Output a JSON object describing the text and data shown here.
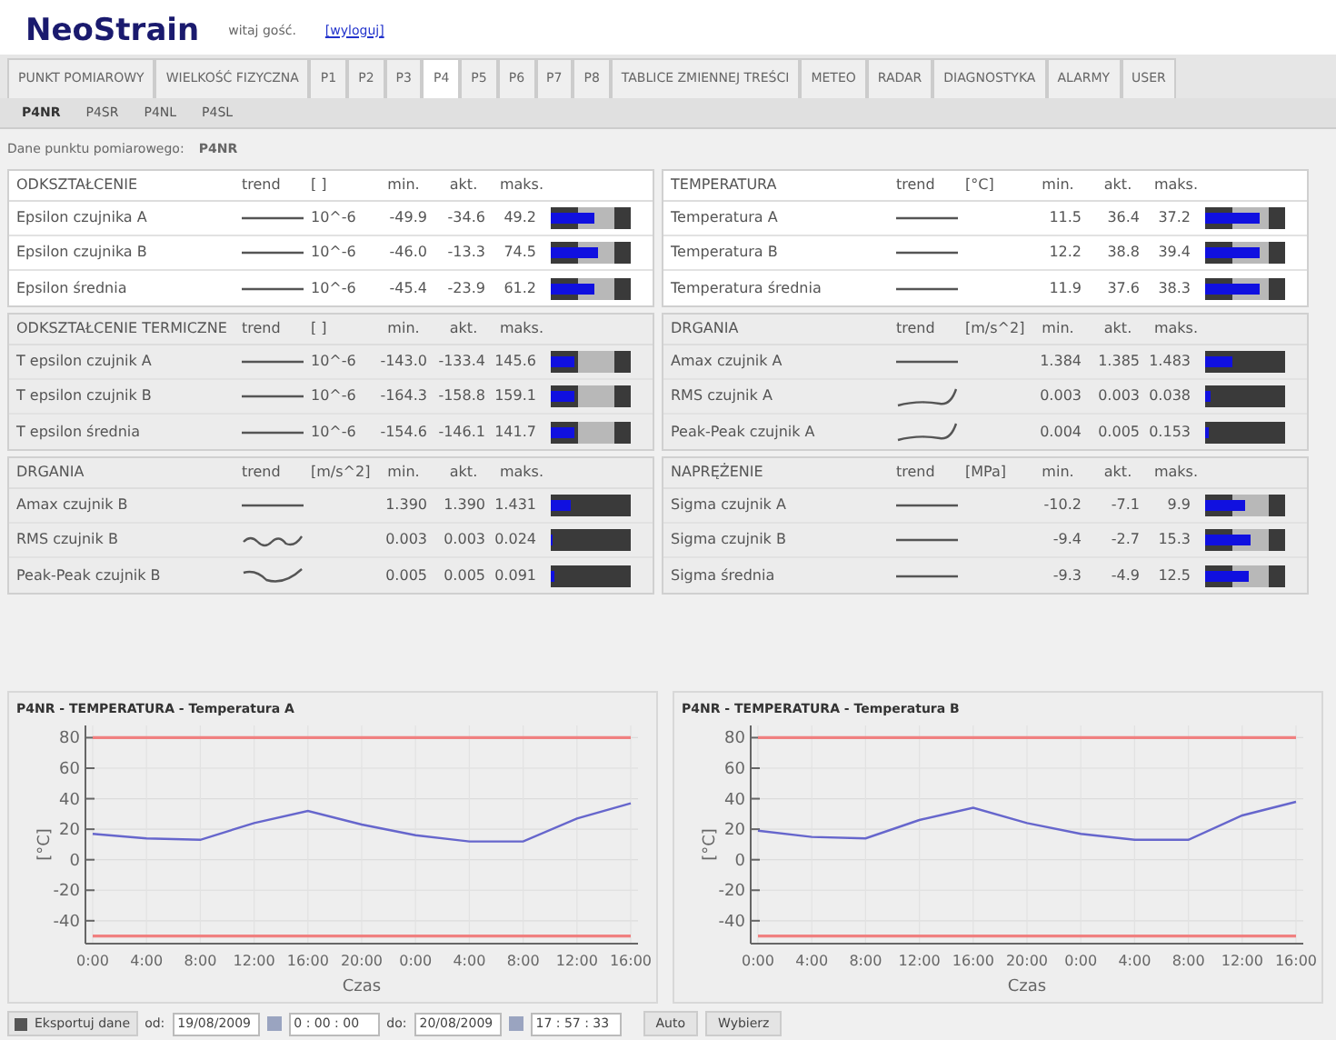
{
  "header": {
    "logo": "NeoStrain",
    "greeting": "witaj gość.",
    "logout": "[wyloguj]"
  },
  "tabs": [
    {
      "label": "PUNKT POMIAROWY",
      "selected": false
    },
    {
      "label": "WIELKOŚĆ FIZYCZNA",
      "selected": false
    },
    {
      "label": "P1",
      "selected": false
    },
    {
      "label": "P2",
      "selected": false
    },
    {
      "label": "P3",
      "selected": false
    },
    {
      "label": "P4",
      "selected": true
    },
    {
      "label": "P5",
      "selected": false
    },
    {
      "label": "P6",
      "selected": false
    },
    {
      "label": "P7",
      "selected": false
    },
    {
      "label": "P8",
      "selected": false
    },
    {
      "label": "TABLICE ZMIENNEJ TREŚCI",
      "selected": false
    },
    {
      "label": "METEO",
      "selected": false
    },
    {
      "label": "RADAR",
      "selected": false
    },
    {
      "label": "DIAGNOSTYKA",
      "selected": false
    },
    {
      "label": "ALARMY",
      "selected": false
    },
    {
      "label": "USER",
      "selected": false
    }
  ],
  "subtabs": [
    {
      "label": "P4NR",
      "selected": true
    },
    {
      "label": "P4SR",
      "selected": false
    },
    {
      "label": "P4NL",
      "selected": false
    },
    {
      "label": "P4SL",
      "selected": false
    }
  ],
  "point_label": "Dane punktu pomiarowego:",
  "point_value": "P4NR",
  "panels": [
    {
      "title": "ODKSZTAŁCENIE",
      "trend": "trend",
      "unit": "[ ]",
      "min": "min.",
      "akt": "akt.",
      "maks": "maks.",
      "highlight": true,
      "rows": [
        {
          "name": "Epsilon czujnika A",
          "kind": "flat",
          "unit": "10^-6",
          "min": "-49.9",
          "akt": "-34.6",
          "maks": "49.2",
          "band": true,
          "level": 0.55
        },
        {
          "name": "Epsilon czujnika B",
          "kind": "flat",
          "unit": "10^-6",
          "min": "-46.0",
          "akt": "-13.3",
          "maks": "74.5",
          "band": true,
          "level": 0.58
        },
        {
          "name": "Epsilon średnia",
          "kind": "flat",
          "unit": "10^-6",
          "min": "-45.4",
          "akt": "-23.9",
          "maks": "61.2",
          "band": true,
          "level": 0.55
        }
      ]
    },
    {
      "title": "TEMPERATURA",
      "trend": "trend",
      "unit": "[°C]",
      "min": "min.",
      "akt": "akt.",
      "maks": "maks.",
      "highlight": true,
      "rows": [
        {
          "name": "Temperatura A",
          "kind": "flat",
          "min": "11.5",
          "akt": "36.4",
          "maks": "37.2",
          "band": true,
          "level": 0.68
        },
        {
          "name": "Temperatura B",
          "kind": "flat",
          "min": "12.2",
          "akt": "38.8",
          "maks": "39.4",
          "band": true,
          "level": 0.68
        },
        {
          "name": "Temperatura średnia",
          "kind": "flat",
          "min": "11.9",
          "akt": "37.6",
          "maks": "38.3",
          "band": true,
          "level": 0.68
        }
      ]
    },
    {
      "title": "ODKSZTAŁCENIE TERMICZNE",
      "trend": "trend",
      "unit": "[ ]",
      "min": "min.",
      "akt": "akt.",
      "maks": "maks.",
      "highlight": false,
      "rows": [
        {
          "name": "T epsilon czujnik A",
          "kind": "flat",
          "unit": "10^-6",
          "min": "-143.0",
          "akt": "-133.4",
          "maks": "145.6",
          "band": true,
          "level": 0.3
        },
        {
          "name": "T epsilon czujnik B",
          "kind": "flat",
          "unit": "10^-6",
          "min": "-164.3",
          "akt": "-158.8",
          "maks": "159.1",
          "band": true,
          "level": 0.3
        },
        {
          "name": "T epsilon średnia",
          "kind": "flat",
          "unit": "10^-6",
          "min": "-154.6",
          "akt": "-146.1",
          "maks": "141.7",
          "band": true,
          "level": 0.3
        }
      ]
    },
    {
      "title": "DRGANIA",
      "trend": "trend",
      "unit": "[m/s^2]",
      "min": "min.",
      "akt": "akt.",
      "maks": "maks.",
      "highlight": false,
      "rows": [
        {
          "name": "Amax czujnik A",
          "kind": "flat",
          "min": "1.384",
          "akt": "1.385",
          "maks": "1.483",
          "band": false,
          "level": 0.35
        },
        {
          "name": "RMS czujnik A",
          "kind": "rise",
          "min": "0.003",
          "akt": "0.003",
          "maks": "0.038",
          "band": false,
          "level": 0.06
        },
        {
          "name": "Peak-Peak czujnik A",
          "kind": "rise",
          "min": "0.004",
          "akt": "0.005",
          "maks": "0.153",
          "band": false,
          "level": 0.04
        }
      ]
    },
    {
      "title": "DRGANIA",
      "trend": "trend",
      "unit": "[m/s^2]",
      "min": "min.",
      "akt": "akt.",
      "maks": "maks.",
      "highlight": false,
      "rows": [
        {
          "name": "Amax czujnik B",
          "kind": "flat",
          "min": "1.390",
          "akt": "1.390",
          "maks": "1.431",
          "band": false,
          "level": 0.25
        },
        {
          "name": "RMS czujnik B",
          "kind": "wavy",
          "min": "0.003",
          "akt": "0.003",
          "maks": "0.024",
          "band": false,
          "level": 0.03
        },
        {
          "name": "Peak-Peak czujnik B",
          "kind": "dip",
          "min": "0.005",
          "akt": "0.005",
          "maks": "0.091",
          "band": false,
          "level": 0.04
        }
      ]
    },
    {
      "title": "NAPRĘŻENIE",
      "trend": "trend",
      "unit": "[MPa]",
      "min": "min.",
      "akt": "akt.",
      "maks": "maks.",
      "highlight": false,
      "rows": [
        {
          "name": "Sigma czujnik A",
          "kind": "flat",
          "min": "-10.2",
          "akt": "-7.1",
          "maks": "9.9",
          "band": true,
          "level": 0.5
        },
        {
          "name": "Sigma czujnik B",
          "kind": "flat",
          "min": "-9.4",
          "akt": "-2.7",
          "maks": "15.3",
          "band": true,
          "level": 0.57
        },
        {
          "name": "Sigma średnia",
          "kind": "flat",
          "min": "-9.3",
          "akt": "-4.9",
          "maks": "12.5",
          "band": true,
          "level": 0.55
        }
      ]
    }
  ],
  "charts": [
    {
      "chart_data": {
        "type": "line",
        "title": "P4NR - TEMPERATURA - Temperatura A",
        "xlabel": "Czas",
        "ylabel": "[°C]",
        "grid": true,
        "categories": [
          "0:00",
          "4:00",
          "8:00",
          "12:00",
          "16:00",
          "20:00",
          "0:00",
          "4:00",
          "8:00",
          "12:00",
          "16:00"
        ],
        "series": [
          {
            "color": "#6666cc",
            "values": [
              17,
              14,
              13,
              24,
              32,
              23,
              16,
              12,
              12,
              27,
              37
            ]
          },
          {
            "color": "#f08080",
            "values": [
              80,
              80,
              80,
              80,
              80,
              80,
              80,
              80,
              80,
              80,
              80
            ]
          },
          {
            "color": "#f08080",
            "values": [
              -50,
              -50,
              -50,
              -50,
              -50,
              -50,
              -50,
              -50,
              -50,
              -50,
              -50
            ]
          }
        ],
        "ylim": [
          -55,
          88
        ],
        "yticks": [
          -40,
          -20,
          0,
          20,
          40,
          60,
          80
        ]
      }
    },
    {
      "chart_data": {
        "type": "line",
        "title": "P4NR - TEMPERATURA - Temperatura B",
        "xlabel": "Czas",
        "ylabel": "[°C]",
        "grid": true,
        "categories": [
          "0:00",
          "4:00",
          "8:00",
          "12:00",
          "16:00",
          "20:00",
          "0:00",
          "4:00",
          "8:00",
          "12:00",
          "16:00"
        ],
        "series": [
          {
            "color": "#6666cc",
            "values": [
              19,
              15,
              14,
              26,
              34,
              24,
              17,
              13,
              13,
              29,
              38
            ]
          },
          {
            "color": "#f08080",
            "values": [
              80,
              80,
              80,
              80,
              80,
              80,
              80,
              80,
              80,
              80,
              80
            ]
          },
          {
            "color": "#f08080",
            "values": [
              -50,
              -50,
              -50,
              -50,
              -50,
              -50,
              -50,
              -50,
              -50,
              -50,
              -50
            ]
          }
        ],
        "ylim": [
          -55,
          88
        ],
        "yticks": [
          -40,
          -20,
          0,
          20,
          40,
          60,
          80
        ]
      }
    }
  ],
  "toolbar": {
    "export": "Eksportuj dane",
    "from_label": "od:",
    "from_date": "19/08/2009",
    "from_time": "0 : 00 : 00",
    "to_label": "do:",
    "to_date": "20/08/2009",
    "to_time": "17 : 57 : 33",
    "auto": "Auto",
    "choose": "Wybierz"
  }
}
